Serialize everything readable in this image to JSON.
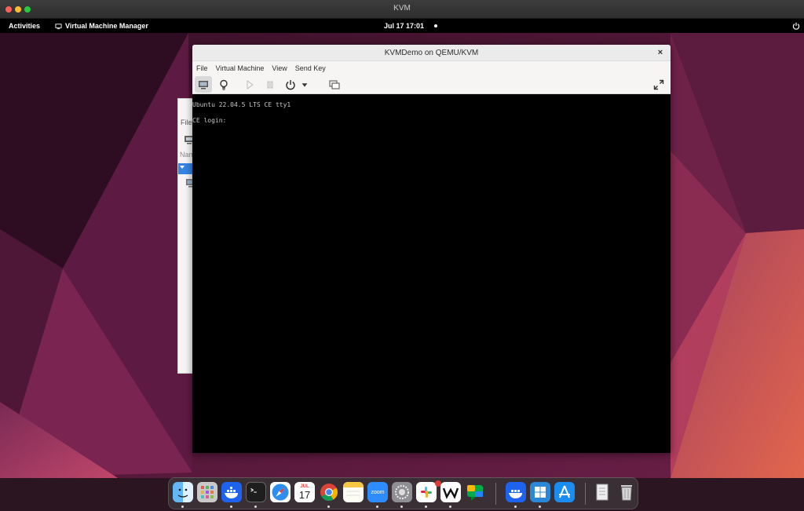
{
  "host_window": {
    "title": "KVM"
  },
  "top_bar": {
    "activities": "Activities",
    "app_name": "Virtual Machine Manager",
    "clock": "Jul 17  17:01"
  },
  "manager_window": {
    "menu_file": "File",
    "column_name": "Nam"
  },
  "vm_window": {
    "title": "KVMDemo on QEMU/KVM",
    "close_glyph": "×",
    "menu": [
      "File",
      "Virtual Machine",
      "View",
      "Send Key"
    ],
    "console_lines": [
      "Ubuntu 22.04.5 LTS CE tty1",
      "CE login:"
    ]
  },
  "dock": {
    "items": [
      "finder",
      "launchpad",
      "docker",
      "terminal",
      "safari",
      "calendar",
      "chrome",
      "notes",
      "zoom",
      "system-settings",
      "slack",
      "wps",
      "google-chat",
      "docker",
      "windows-app",
      "app-store",
      "document",
      "trash"
    ],
    "calendar": {
      "month": "JUL",
      "day": "17"
    },
    "zoom_label": "zoom",
    "slack_badge": ""
  },
  "colors": {
    "accent": "#3584e4",
    "console_bg": "#000000",
    "top_bar": "#000000"
  }
}
